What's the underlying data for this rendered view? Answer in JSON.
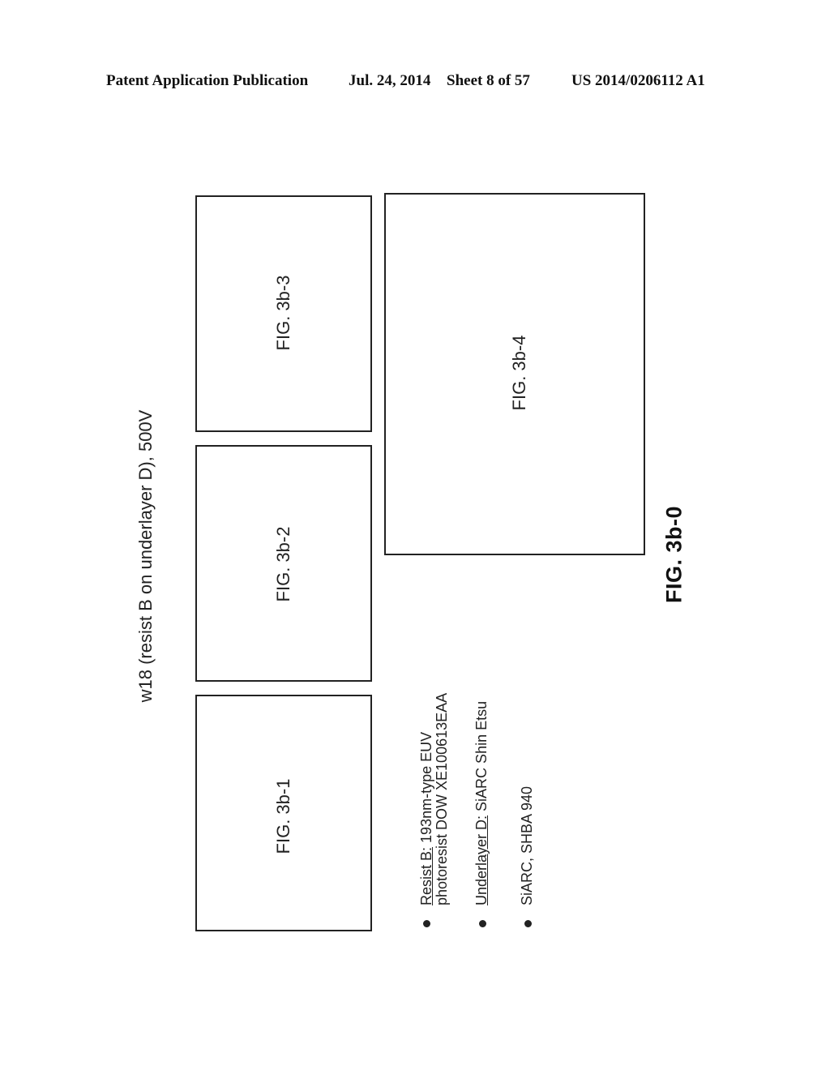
{
  "header": {
    "left": "Patent Application Publication",
    "date": "Jul. 24, 2014",
    "sheet": "Sheet 8 of 57",
    "number": "US 2014/0206112 A1"
  },
  "title": "w18 (resist B on underlayer D), 500V",
  "panels": [
    {
      "label": "FIG. 3b-3"
    },
    {
      "label": "FIG. 3b-2"
    },
    {
      "label": "FIG. 3b-1"
    },
    {
      "label": "FIG. 3b-4"
    }
  ],
  "notes": [
    {
      "term": "Resist B:",
      "text": " 193nm-type EUV",
      "line2": "photoresist DOW XE100613EAA"
    },
    {
      "term": "Underlayer D:",
      "text": " SiARC Shin Etsu",
      "line2": ""
    },
    {
      "term": "",
      "text": "SiARC, SHBA 940",
      "line2": ""
    }
  ],
  "figure_caption": "FIG. 3b-0"
}
